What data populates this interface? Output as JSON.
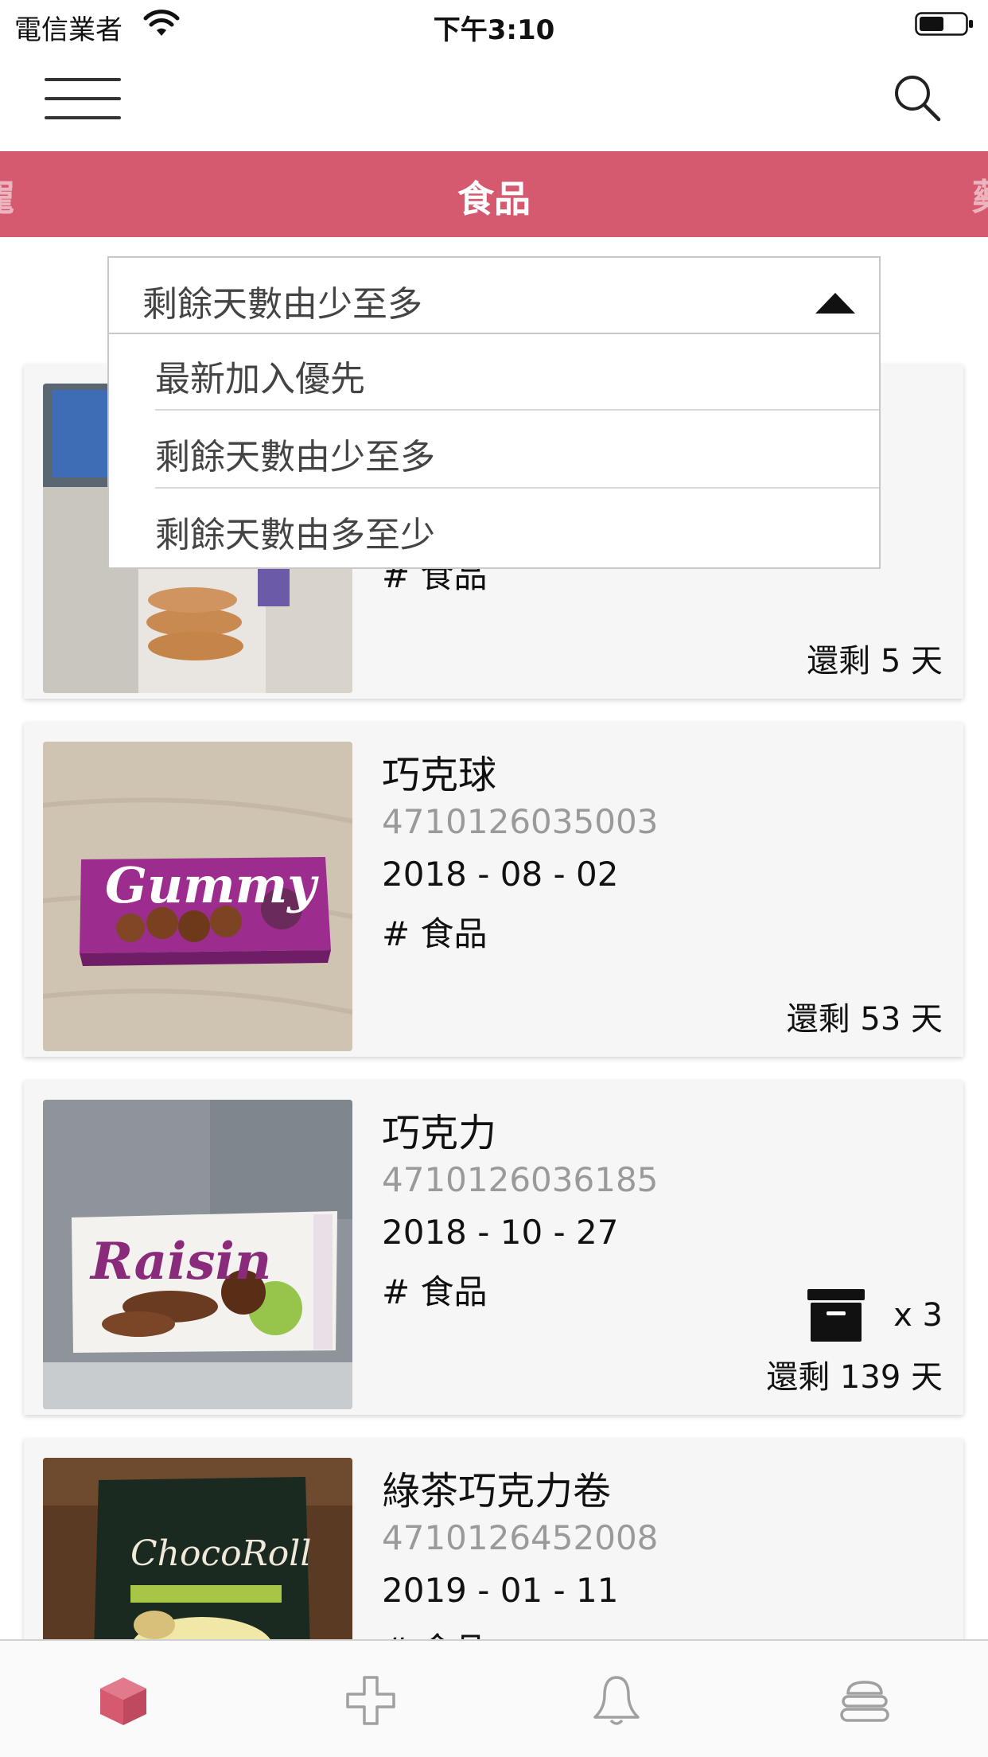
{
  "status_bar": {
    "carrier": "電信業者",
    "time": "下午3:10"
  },
  "nav": {
    "menu_icon": "hamburger-menu-icon",
    "search_icon": "search-icon"
  },
  "categories": {
    "previous": "寵",
    "active": "食品",
    "next": "藥"
  },
  "sort": {
    "selected": "剩餘天數由少至多",
    "options": [
      "最新加入優先",
      "剩餘天數由少至多",
      "剩餘天數由多至少"
    ]
  },
  "items": [
    {
      "name": "",
      "barcode": "",
      "date": "",
      "tag": "# 食品",
      "remaining": "還剩 5 天",
      "stock": null
    },
    {
      "name": "巧克球",
      "barcode": "4710126035003",
      "date": "2018 - 08 - 02",
      "tag": "# 食品",
      "remaining": "還剩 53 天",
      "stock": null,
      "package_text": "Gummy"
    },
    {
      "name": "巧克力",
      "barcode": "4710126036185",
      "date": "2018 - 10 - 27",
      "tag": "# 食品",
      "remaining": "還剩 139 天",
      "stock": "x 3",
      "package_text": "Raisin"
    },
    {
      "name": "綠茶巧克力卷",
      "barcode": "4710126452008",
      "date": "2019 - 01 - 11",
      "tag": "# 食品",
      "remaining": "",
      "stock": null,
      "package_text": "ChocoRoll"
    }
  ],
  "tab_bar": {
    "tabs": [
      {
        "icon": "box-icon",
        "active": true
      },
      {
        "icon": "plus-icon",
        "active": false
      },
      {
        "icon": "bell-icon",
        "active": false
      },
      {
        "icon": "layers-icon",
        "active": false
      }
    ],
    "active_color": "#d55a6f",
    "inactive_color": "#a0a0a0"
  },
  "colors": {
    "accent": "#d55a6f"
  }
}
